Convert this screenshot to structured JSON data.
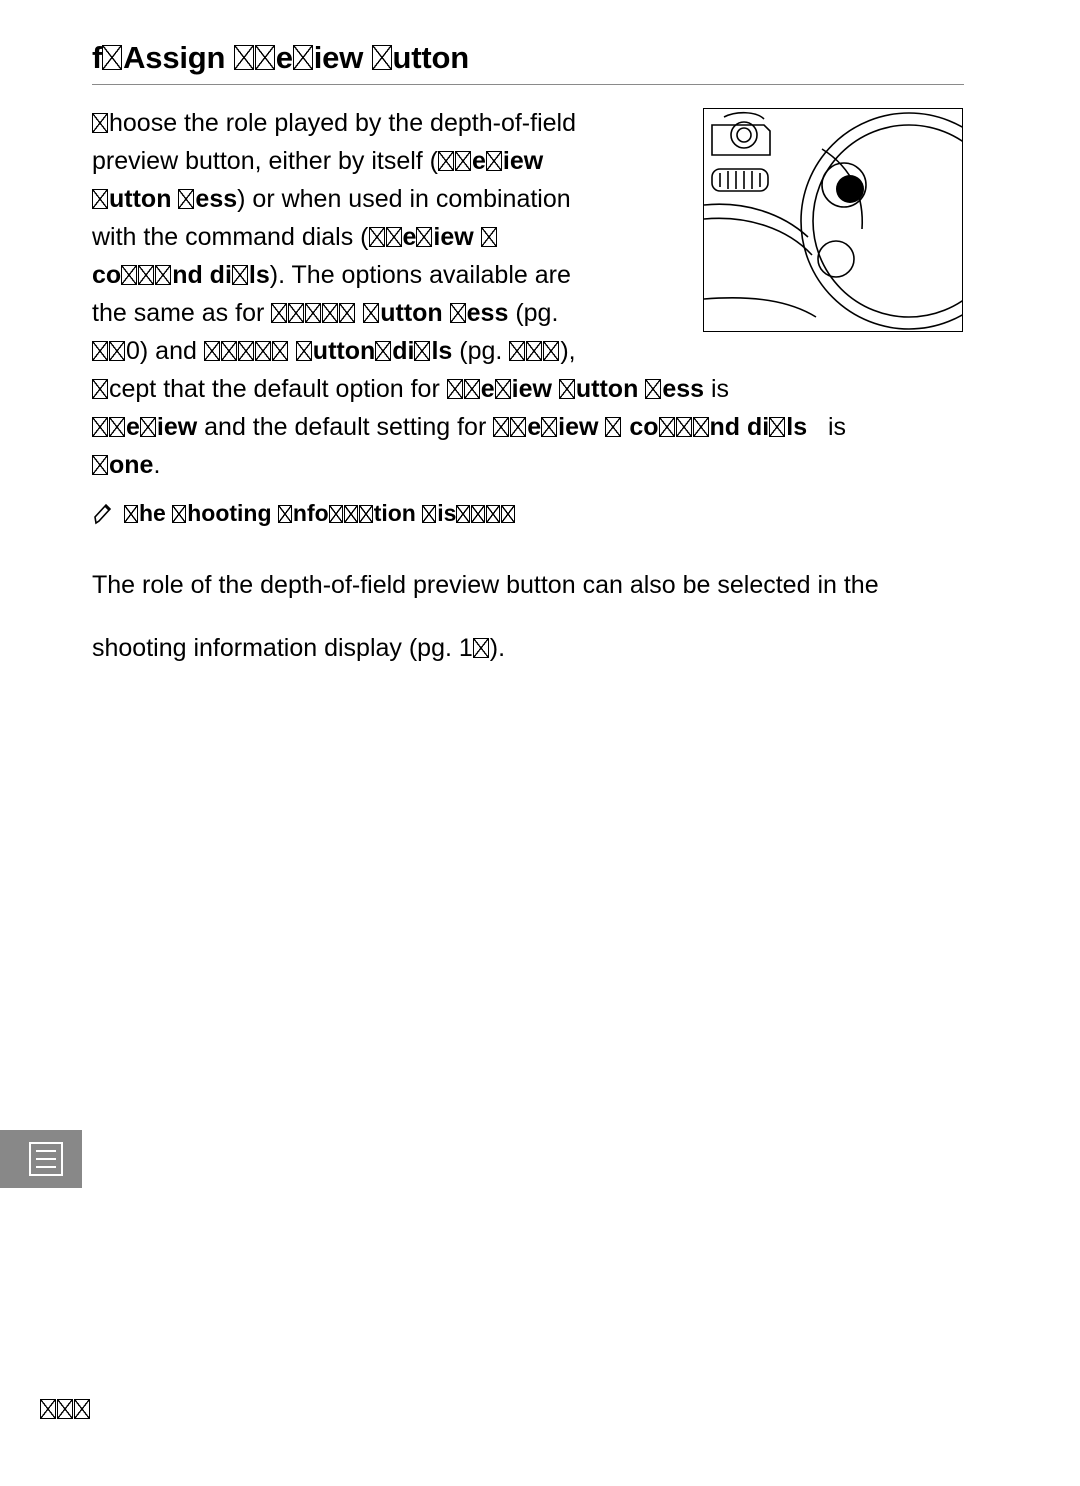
{
  "heading": {
    "prefix": "f",
    "text_parts": [
      "Assign ",
      "e",
      "iew ",
      "utton"
    ],
    "full_text": "f□ Assign □□e□iew □utton"
  },
  "body_column": {
    "line1": "hoose the role played by the depth-of-field",
    "line2": "preview button, either by itself (",
    "line2b": "e",
    "line2c": "iew",
    "line3a": "utton ",
    "line3b": "ess",
    "line3c": ") or when used in combination",
    "line4": "with the command dials (",
    "line4b": "e",
    "line4c": "iew ",
    "line5a": "co",
    "line5b": "nd di",
    "line5c": "ls",
    "line5d": ").  The options available are",
    "line6": "the same as for",
    "line6b": "utton ",
    "line6c": "ess",
    "line6d": "(pg.",
    "line7a": "0) and",
    "line7b": "utton",
    "line7c": "di",
    "line7d": "ls",
    "line7e": "(pg.",
    "line7f": "),"
  },
  "body_full": {
    "l1a": "cept that the default option for ",
    "l1b": "e",
    "l1c": "iew ",
    "l1d": "utton ",
    "l1e": "ess",
    "l1f": " is",
    "l2a": "e",
    "l2b": "iew",
    "l2c": " and the default setting for ",
    "l2d": "e",
    "l2e": "iew ",
    "l2f": " co",
    "l2g": "nd di",
    "l2h": "ls",
    "l2i": "is",
    "l3a": "one",
    "l3b": "."
  },
  "note": {
    "icon": "pencil-icon",
    "heading_parts": [
      "he ",
      "hooting ",
      "nfo",
      "tion ",
      "is",
      ""
    ],
    "heading_text": "□he □hooting □nfo□□□tion □is□□□□",
    "line1": "The role of the depth-of-field preview button can also be selected in the",
    "line2a": "shooting information display (pg. 1",
    "line2b": ")."
  },
  "tab": {
    "icon": "menu-list-icon"
  },
  "page_number": "□□□",
  "figure": {
    "name": "camera-body-diagram",
    "caption": ""
  },
  "colors": {
    "rule": "#8a8a8a",
    "tab_background": "#888888",
    "text": "#000000",
    "background": "#ffffff"
  }
}
